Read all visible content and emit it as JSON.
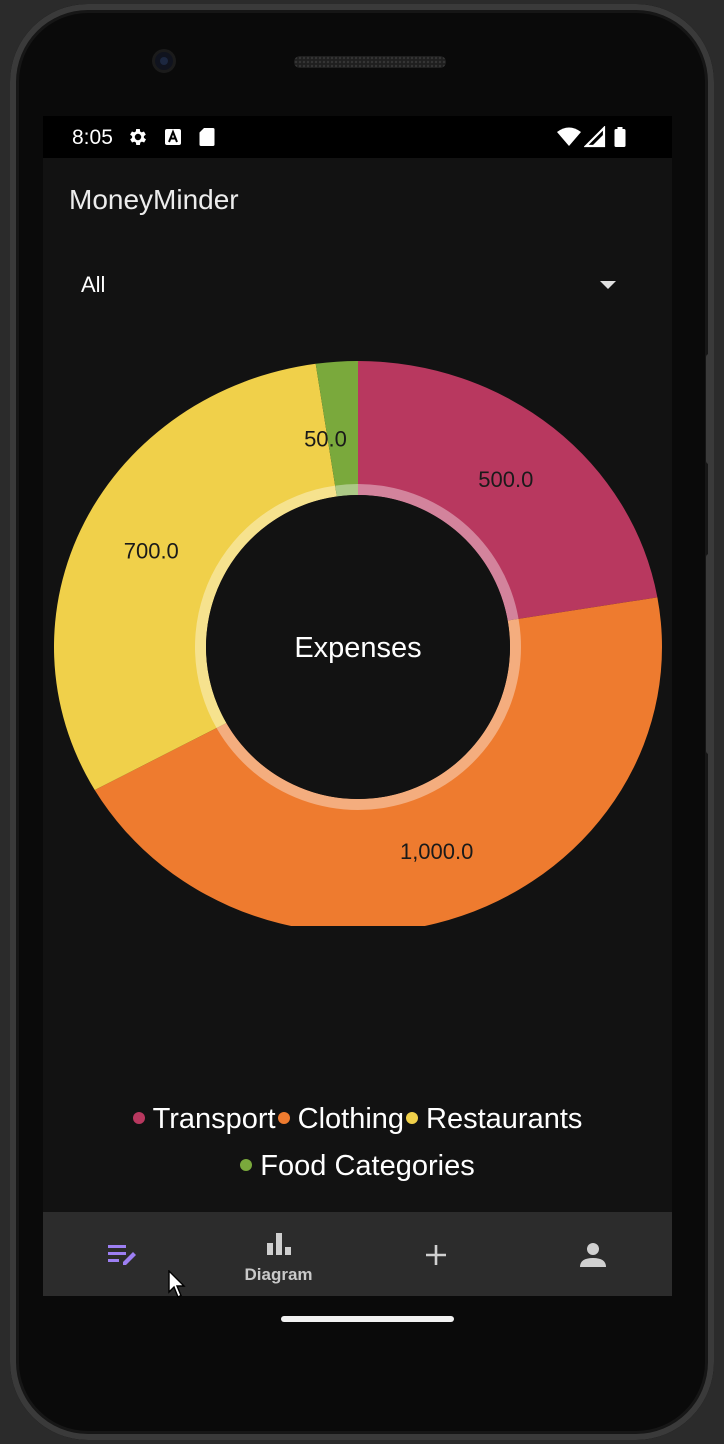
{
  "status_bar": {
    "time": "8:05",
    "left_icons": [
      "gear-icon",
      "a-icon",
      "sd-card-icon"
    ],
    "right_icons": [
      "wifi-icon",
      "signal-icon",
      "battery-icon"
    ]
  },
  "app": {
    "title": "MoneyMinder"
  },
  "filter": {
    "selected": "All",
    "icon": "dropdown-arrow-icon"
  },
  "chart_data": {
    "type": "pie",
    "donut": true,
    "center_label": "Expenses",
    "categories": [
      "Transport",
      "Clothing",
      "Restaurants",
      "Food Categories"
    ],
    "values": [
      500,
      1000,
      700,
      50
    ],
    "value_labels": [
      "500.0",
      "1,000.0",
      "700.0",
      "50.0"
    ],
    "colors": [
      "#b8385f",
      "#ee7b2f",
      "#f0d04a",
      "#7aa93c"
    ],
    "legend_position": "bottom"
  },
  "legend": {
    "items": [
      {
        "label": "Transport",
        "color": "#b8385f"
      },
      {
        "label": "Clothing",
        "color": "#ee7b2f"
      },
      {
        "label": "Restaurants",
        "color": "#f0d04a"
      },
      {
        "label": "Food Categories",
        "color": "#7aa93c"
      }
    ]
  },
  "bottom_nav": {
    "items": [
      {
        "icon": "notes-edit-icon",
        "label": "",
        "active": true
      },
      {
        "icon": "bar-chart-icon",
        "label": "Diagram",
        "active": false
      },
      {
        "icon": "plus-icon",
        "label": "",
        "active": false
      },
      {
        "icon": "person-icon",
        "label": "",
        "active": false
      }
    ]
  },
  "colors": {
    "background": "#121212",
    "nav_background": "#2c2c2c",
    "active_nav_icon": "#9d7ff3"
  }
}
